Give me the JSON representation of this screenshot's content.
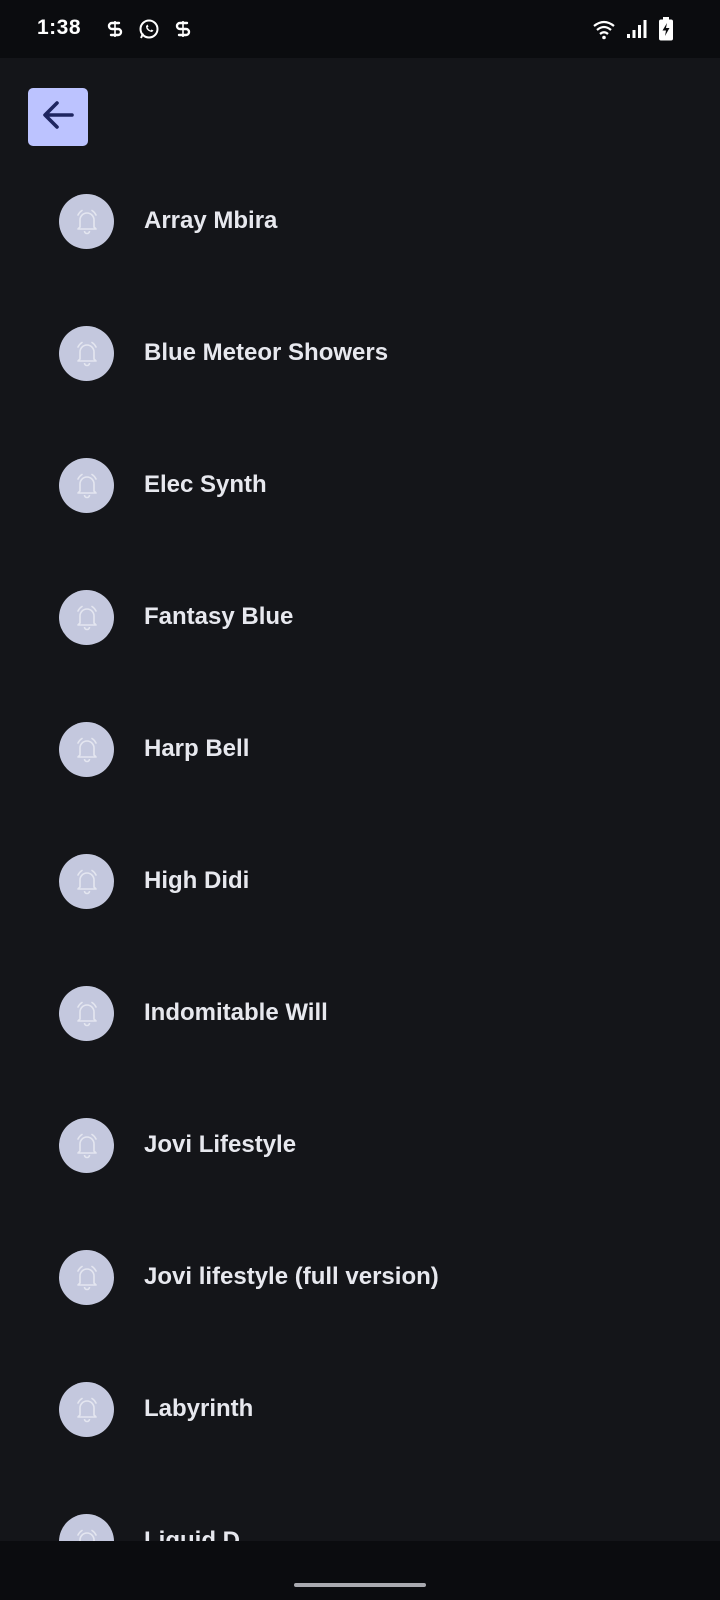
{
  "status_bar": {
    "time": "1:38",
    "notification_icons": [
      "swiggy-icon",
      "whatsapp-icon",
      "swiggy-icon"
    ],
    "right_icons": [
      "wifi-icon",
      "signal-icon",
      "battery-charging-icon"
    ]
  },
  "header": {
    "back_icon": "arrow-left-icon",
    "accent_color": "#bcc3ff",
    "icon_color": "#1e2560"
  },
  "ringtones": [
    {
      "name": "Array Mbira",
      "icon": "bell-icon"
    },
    {
      "name": "Blue Meteor Showers",
      "icon": "bell-icon"
    },
    {
      "name": "Elec Synth",
      "icon": "bell-icon"
    },
    {
      "name": "Fantasy Blue",
      "icon": "bell-icon"
    },
    {
      "name": "Harp Bell",
      "icon": "bell-icon"
    },
    {
      "name": "High Didi",
      "icon": "bell-icon"
    },
    {
      "name": "Indomitable Will",
      "icon": "bell-icon"
    },
    {
      "name": "Jovi Lifestyle",
      "icon": "bell-icon"
    },
    {
      "name": "Jovi lifestyle (full version)",
      "icon": "bell-icon"
    },
    {
      "name": "Labyrinth",
      "icon": "bell-icon"
    },
    {
      "name": "Liquid D",
      "icon": "bell-icon"
    }
  ],
  "colors": {
    "background": "#141519",
    "status_bar": "#0b0c0f",
    "avatar": "#c4c8de",
    "text": "#e7e8ee"
  }
}
